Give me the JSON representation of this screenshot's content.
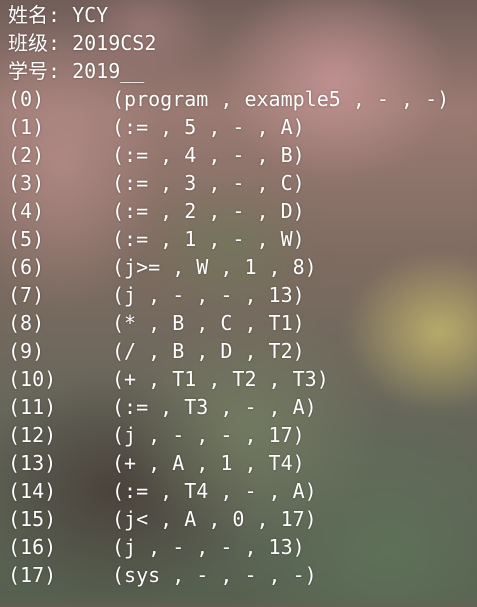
{
  "header": {
    "name_line": "姓名: YCY",
    "class_line": "班级: 2019CS2",
    "id_line": "学号: 2019__"
  },
  "quadruples": [
    {
      "index": "(0)",
      "quad": "(program , example5 , - , -)"
    },
    {
      "index": "(1)",
      "quad": "(:= , 5 , - , A)"
    },
    {
      "index": "(2)",
      "quad": "(:= , 4 , - , B)"
    },
    {
      "index": "(3)",
      "quad": "(:= , 3 , - , C)"
    },
    {
      "index": "(4)",
      "quad": "(:= , 2 , - , D)"
    },
    {
      "index": "(5)",
      "quad": "(:= , 1 , - , W)"
    },
    {
      "index": "(6)",
      "quad": "(j>= , W , 1 , 8)"
    },
    {
      "index": "(7)",
      "quad": "(j , - , - , 13)"
    },
    {
      "index": "(8)",
      "quad": "(* , B , C , T1)"
    },
    {
      "index": "(9)",
      "quad": "(/ , B , D , T2)"
    },
    {
      "index": "(10)",
      "quad": "(+ , T1 , T2 , T3)"
    },
    {
      "index": "(11)",
      "quad": "(:= , T3 , - , A)"
    },
    {
      "index": "(12)",
      "quad": "(j , - , - , 17)"
    },
    {
      "index": "(13)",
      "quad": "(+ , A , 1 , T4)"
    },
    {
      "index": "(14)",
      "quad": "(:= , T4 , - , A)"
    },
    {
      "index": "(15)",
      "quad": "(j< , A , 0 , 17)"
    },
    {
      "index": "(16)",
      "quad": "(j , - , - , 13)"
    },
    {
      "index": "(17)",
      "quad": "(sys , - , - , -)"
    }
  ]
}
